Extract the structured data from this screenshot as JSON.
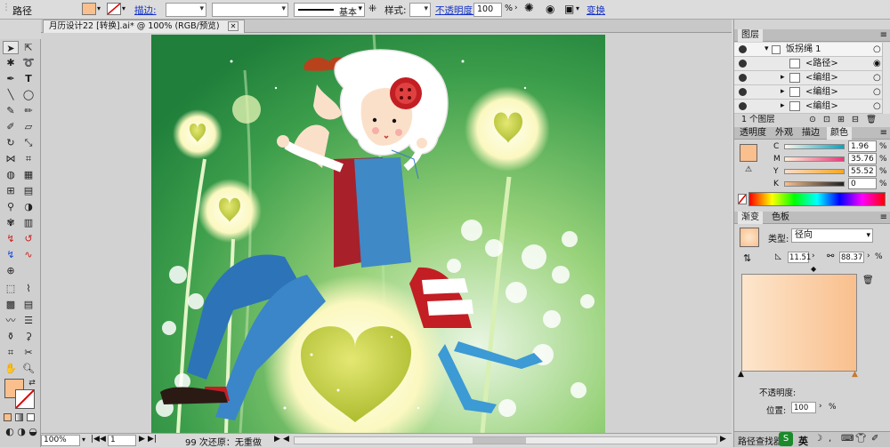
{
  "control_bar": {
    "object_type": "路径",
    "stroke_label": "描边:",
    "stroke_profile": "基本",
    "style_label": "样式:",
    "opacity_label": "不透明度:",
    "opacity_value": "100",
    "opacity_unit": "%",
    "transform_label": "变换"
  },
  "document": {
    "tab_title": "月历设计22 [转换].ai* @ 100% (RGB/预览)"
  },
  "status": {
    "zoom": "100%",
    "artboard": "1",
    "history": "99 次还原：无重做"
  },
  "layers_panel": {
    "title": "图层",
    "rows": [
      {
        "label": "饭拐绳 1",
        "expanded": true
      },
      {
        "label": "<路径>"
      },
      {
        "label": "<编组>"
      },
      {
        "label": "<编组>"
      },
      {
        "label": "<编组>"
      }
    ],
    "footer": "1 个图层"
  },
  "color_panel": {
    "tabs": [
      "透明度",
      "外观",
      "描边",
      "颜色"
    ],
    "active_tab": "颜色",
    "channels": [
      {
        "name": "C",
        "value": "1.96",
        "unit": "%"
      },
      {
        "name": "M",
        "value": "35.76",
        "unit": "%"
      },
      {
        "name": "Y",
        "value": "55.52",
        "unit": "%"
      },
      {
        "name": "K",
        "value": "0",
        "unit": "%"
      }
    ],
    "swatch_color": "#f9bf8d"
  },
  "gradient_panel": {
    "tabs": [
      "渐变",
      "色板"
    ],
    "active_tab": "渐变",
    "type_label": "类型:",
    "type_value": "径向",
    "angle_value": "11.51",
    "aspect_value": "88.37",
    "aspect_unit": "%",
    "location_label": "位置:",
    "location_value": "100",
    "location_unit": "%"
  },
  "bottom_strip": {
    "pathfinder_label": "路径查找器",
    "ime_label": "英"
  },
  "colors": {
    "fill": "#f9bf8d",
    "link": "#1230c8",
    "panel_bg": "#d4d4d4"
  },
  "icons": [
    "selection-tool-icon",
    "pen-tool-icon",
    "type-tool-icon",
    "gradient-tool-icon",
    "zoom-tool-icon",
    "eye-icon",
    "new-layer-icon",
    "trash-icon"
  ]
}
